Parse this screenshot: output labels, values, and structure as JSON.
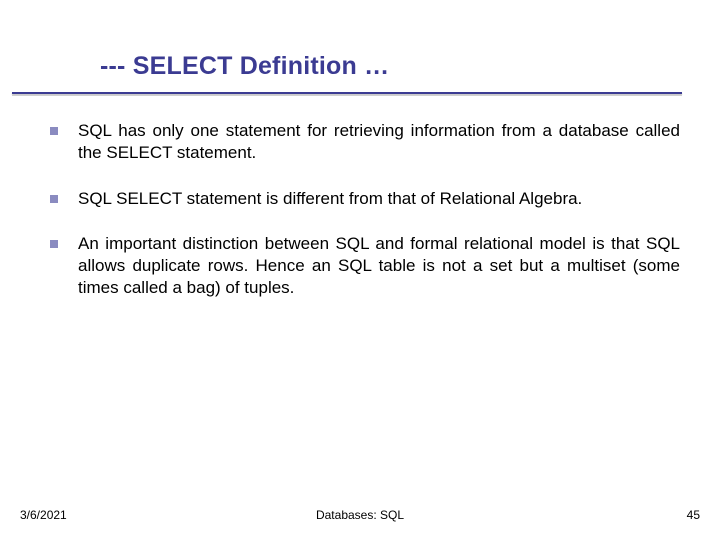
{
  "title": "--- SELECT Definition …",
  "bullets": [
    "SQL has only one statement for retrieving information from a database called the SELECT statement.",
    "SQL SELECT statement is different from that of Relational Algebra.",
    "An important distinction between SQL and formal relational model is that SQL allows duplicate rows. Hence an SQL table is not a set but a multiset (some times called a bag) of tuples."
  ],
  "footer": {
    "date": "3/6/2021",
    "center": "Databases: SQL",
    "page": "45"
  },
  "colors": {
    "title": "#3b3b92",
    "bullet_marker": "#8a8bc0"
  }
}
